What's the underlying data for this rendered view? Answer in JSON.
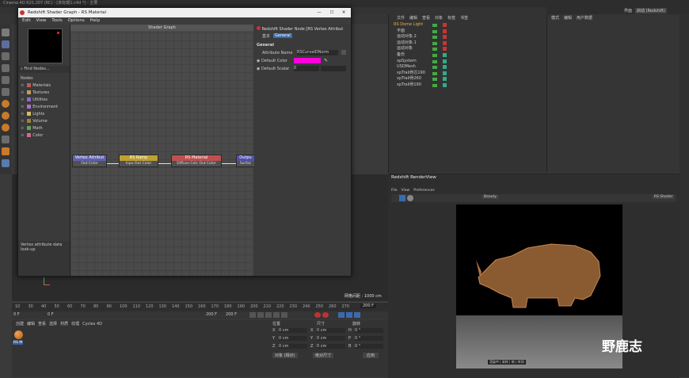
{
  "c4d": {
    "title": "Cinema 4D R21.207 (RC) - [未标题1.c4d *] - 主要",
    "layout_label": "界面",
    "layout_value": "启动 (Redshift)"
  },
  "shader_graph": {
    "window_title": "Redshift Shader Graph - RS Material",
    "menu": [
      "Edit",
      "View",
      "Tools",
      "Options",
      "Help"
    ],
    "find_nodes": "Find Nodes...",
    "nodes_heading": "Nodes",
    "categories": [
      {
        "label": "Materials",
        "color": "#c05a5a"
      },
      {
        "label": "Textures",
        "color": "#c0a050"
      },
      {
        "label": "Utilities",
        "color": "#8a6ad0"
      },
      {
        "label": "Environment",
        "color": "#b070c0"
      },
      {
        "label": "Lights",
        "color": "#d0c060"
      },
      {
        "label": "Volume",
        "color": "#a08040"
      },
      {
        "label": "Math",
        "color": "#60a060"
      },
      {
        "label": "Color",
        "color": "#d06a8a"
      }
    ],
    "description": "Vertex attribute data look-up",
    "canvas_title": "Shader Graph",
    "nodes": [
      {
        "title": "Vertex Attribut",
        "port": "Out Color",
        "color": "#6060b0"
      },
      {
        "title": "RS Ramp",
        "port": "Inpu Out Color",
        "color": "#c0a030"
      },
      {
        "title": "RS Material",
        "port": "Diffuse Colc Out Color",
        "color": "#c05050"
      },
      {
        "title": "Outpu",
        "port": "Surfac",
        "color": "#5050b0"
      }
    ],
    "props": {
      "node_title": "Redshift Shader Node [RS Vertex Attribut",
      "tab_basic": "基本",
      "tab_general": "General",
      "section": "General",
      "attr_name_label": "Attribute Name",
      "attr_name_value": "RSCurveIDNorm",
      "default_color_label": "Default Color",
      "default_color_value": "#ff00dc",
      "default_scalar_label": "Default Scalar",
      "default_scalar_value": "0"
    }
  },
  "object_manager": {
    "menu": [
      "文件",
      "编辑",
      "查看",
      "对象",
      "标签",
      "书签"
    ],
    "objects": [
      {
        "name": "RS Dome Light",
        "highlight": true
      },
      {
        "name": "平面"
      },
      {
        "name": "运动对象.2"
      },
      {
        "name": "运动对象.1"
      },
      {
        "name": "运动对象"
      },
      {
        "name": "备份"
      },
      {
        "name": "xpSystem"
      },
      {
        "name": "USDMesh"
      },
      {
        "name": "xpTrail骨芯190"
      },
      {
        "name": "xpTrail骨260"
      },
      {
        "name": "xpTrail骨190"
      }
    ]
  },
  "attributes": {
    "menu": [
      "模式",
      "编辑",
      "用户数据"
    ]
  },
  "viewport": {
    "grid_label": "网格间距 : 1000 cm"
  },
  "timeline": {
    "ticks": [
      "10",
      "30",
      "40",
      "50",
      "60",
      "70",
      "80",
      "90",
      "100",
      "110",
      "120",
      "130",
      "140",
      "150",
      "160",
      "170",
      "180",
      "190",
      "200",
      "210",
      "220",
      "230",
      "240",
      "250",
      "260",
      "270"
    ],
    "start": "0 F",
    "current": "0 F",
    "end1": "200 F",
    "end2": "200 F",
    "frame_out": "200 F"
  },
  "materials": {
    "menu": [
      "创建",
      "编辑",
      "查看",
      "选择",
      "材质",
      "纹理",
      "Cycles 4D"
    ],
    "item_label": "RS M"
  },
  "coords": {
    "headers": [
      "位置",
      "尺寸",
      "旋转"
    ],
    "rows": [
      {
        "axis": "X",
        "pos": "0 cm",
        "size_axis": "X",
        "size": "0 cm",
        "rot_axis": "H",
        "rot": "0 °"
      },
      {
        "axis": "Y",
        "pos": "0 cm",
        "size_axis": "Y",
        "size": "0 cm",
        "rot_axis": "P",
        "rot": "0 °"
      },
      {
        "axis": "Z",
        "pos": "0 cm",
        "size_axis": "Z",
        "size": "0 cm",
        "rot_axis": "B",
        "rot": "0 °"
      }
    ],
    "mode1": "对象 (相对)",
    "mode2": "绝对尺寸",
    "apply": "应用"
  },
  "render_view": {
    "title": "Redshift RenderView",
    "menu": [
      "File",
      "View",
      "Preferences"
    ],
    "beauty": "Beauty",
    "shader": "RS Shader",
    "status": "渲染中 | 采样 | 帧 | 时间"
  },
  "watermark": "野鹿志"
}
